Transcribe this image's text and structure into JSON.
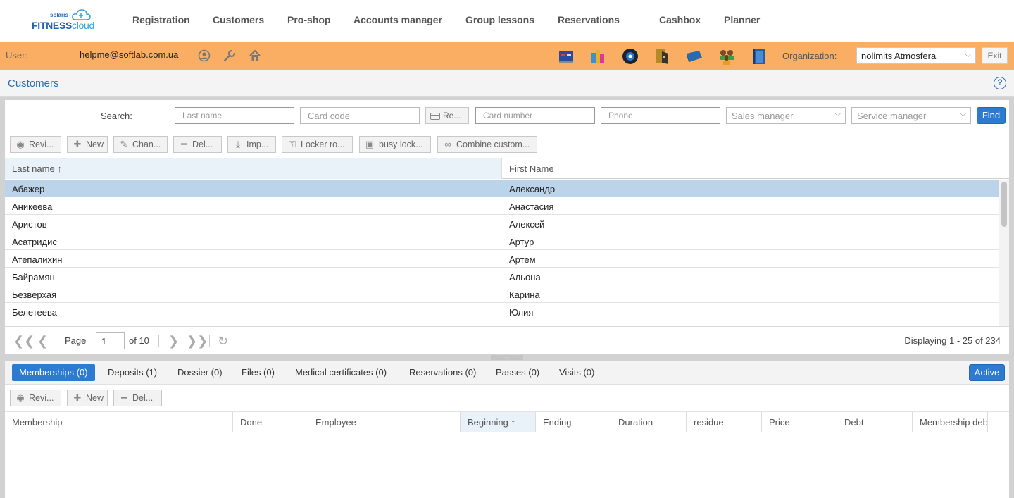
{
  "logo": {
    "small": "solaris",
    "brand_main": "FITNESS",
    "brand_cloud": "cloud"
  },
  "nav": [
    "Registration",
    "Customers",
    "Pro-shop",
    "Accounts manager",
    "Group lessons",
    "Reservations",
    "Cashbox",
    "Planner"
  ],
  "userbar": {
    "user_label": "User:",
    "email": "helpme@softlab.com.ua",
    "org_label": "Organization:",
    "org_value": "nolimits Atmosfera",
    "exit_label": "Exit",
    "bg_color": "#f9ae63"
  },
  "panel": {
    "title": "Customers",
    "help": "?"
  },
  "search": {
    "label": "Search:",
    "last_name_ph": "Last name",
    "card_code_ph": "Card code",
    "reader_btn": "Re...",
    "card_number_ph": "Card number",
    "phone_ph": "Phone",
    "sales_manager": "Sales manager",
    "service_manager": "Service manager",
    "find": "Find"
  },
  "toolbar": {
    "review": "Revi...",
    "new": "New",
    "change": "Chan...",
    "delete": "Del...",
    "import": "Imp...",
    "locker_room": "Locker ro...",
    "busy_locker": "busy lock...",
    "combine": "Combine custom..."
  },
  "grid": {
    "col_last_name": "Last name",
    "col_first_name": "First Name",
    "rows": [
      [
        "Абажер",
        "Александр"
      ],
      [
        "Аникеева",
        "Анастасия"
      ],
      [
        "Аристов",
        "Алексей"
      ],
      [
        "Асатридис",
        "Артур"
      ],
      [
        "Атепалихин",
        "Артем"
      ],
      [
        "Байрамян",
        "Альона"
      ],
      [
        "Безверхая",
        "Карина"
      ],
      [
        "Белетеева",
        "Юлия"
      ]
    ]
  },
  "pager": {
    "page_label": "Page",
    "page_value": "1",
    "of_label": "of 10",
    "display": "Displaying 1 - 25 of 234"
  },
  "tabs": [
    "Memberships (0)",
    "Deposits (1)",
    "Dossier (0)",
    "Files (0)",
    "Medical certificates (0)",
    "Reservations (0)",
    "Passes (0)",
    "Visits (0)"
  ],
  "active_btn": "Active",
  "lower_toolbar": {
    "review": "Revi...",
    "new": "New",
    "delete": "Del..."
  },
  "membership_cols": [
    "Membership",
    "Done",
    "Employee",
    "Beginning",
    "Ending",
    "Duration",
    "residue",
    "Price",
    "Debt",
    "Membership deb"
  ],
  "colors": {
    "accent": "#2d7bd1",
    "selected_row": "#bcd4ea",
    "title": "#2a6cb3"
  }
}
